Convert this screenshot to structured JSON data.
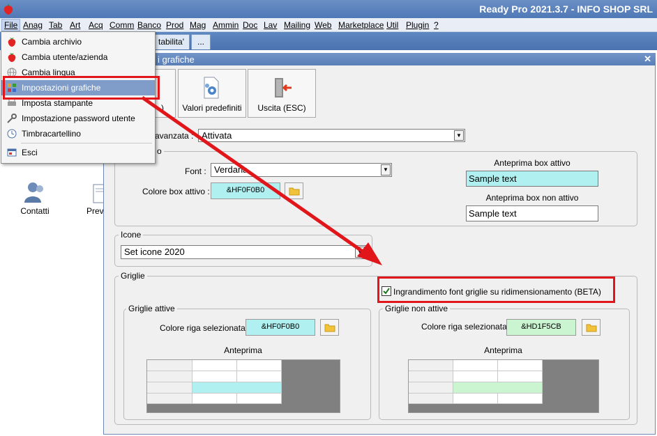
{
  "app": {
    "title": "Ready Pro 2021.3.7 - INFO SHOP SRL"
  },
  "menubar": {
    "items": [
      "File",
      "Anag",
      "Tab",
      "Art",
      "Acq",
      "Comm",
      "Banco",
      "Prod",
      "Mag",
      "Ammin",
      "Doc",
      "Lav",
      "Mailing",
      "Web",
      "Marketplace",
      "Util",
      "Plugin",
      "?"
    ]
  },
  "tabs": {
    "partial_label": "tabilita'",
    "more_label": "..."
  },
  "file_menu": {
    "items": [
      {
        "label": "Cambia archivio",
        "icon": "strawberry-icon"
      },
      {
        "label": "Cambia utente/azienda",
        "icon": "strawberry-icon"
      },
      {
        "label": "Cambia lingua",
        "icon": "globe-icon"
      },
      {
        "label": "Impostazioni grafiche",
        "icon": "palette-icon"
      },
      {
        "label": "Imposta stampante",
        "icon": "printer-icon"
      },
      {
        "label": "Impostazione password utente",
        "icon": "key-icon"
      },
      {
        "label": "Timbracartellino",
        "icon": "clock-icon"
      },
      {
        "label": "Esci",
        "icon": "exit-window-icon"
      }
    ],
    "selected_index": 3
  },
  "desktop": {
    "items": [
      {
        "label": "Contatti",
        "icon": "contacts-icon"
      },
      {
        "label": "Prev",
        "icon": "document-icon"
      }
    ]
  },
  "window": {
    "title": "i grafiche",
    "toolbar": {
      "btn_partial_label": ")",
      "defaults_label": "Valori predefiniti",
      "exit_label": "Uscita (ESC)"
    },
    "advanced": {
      "label": "avanzata :",
      "value": "Attivata"
    },
    "box_group": {
      "legend": "o",
      "font_label": "Font :",
      "font_value": "Verdana",
      "active_color_label": "Colore box attivo :",
      "active_color_value": "&HF0F0B0",
      "preview_active_label": "Anteprima box attivo",
      "preview_active_text": "Sample text",
      "preview_inactive_label": "Anteprima box non attivo",
      "preview_inactive_text": "Sample text"
    },
    "icons_group": {
      "legend": "Icone",
      "value": "Set icone 2020"
    },
    "grids_group": {
      "legend": "Griglie",
      "beta_checkbox_label": "Ingrandimento font griglie su ridimensionamento (BETA)",
      "beta_checked": true,
      "active": {
        "legend": "Griglie attive",
        "color_label": "Colore riga selezionata :",
        "color_value": "&HF0F0B0",
        "preview_label": "Anteprima"
      },
      "inactive": {
        "legend": "Griglie non attive",
        "color_label": "Colore riga selezionata :",
        "color_value": "&HD1F5CB",
        "preview_label": "Anteprima"
      }
    }
  },
  "colors": {
    "active_box": "#B0F0F0",
    "inactive_grid_row": "#CBF5D1",
    "highlight_red": "#E0161B"
  }
}
